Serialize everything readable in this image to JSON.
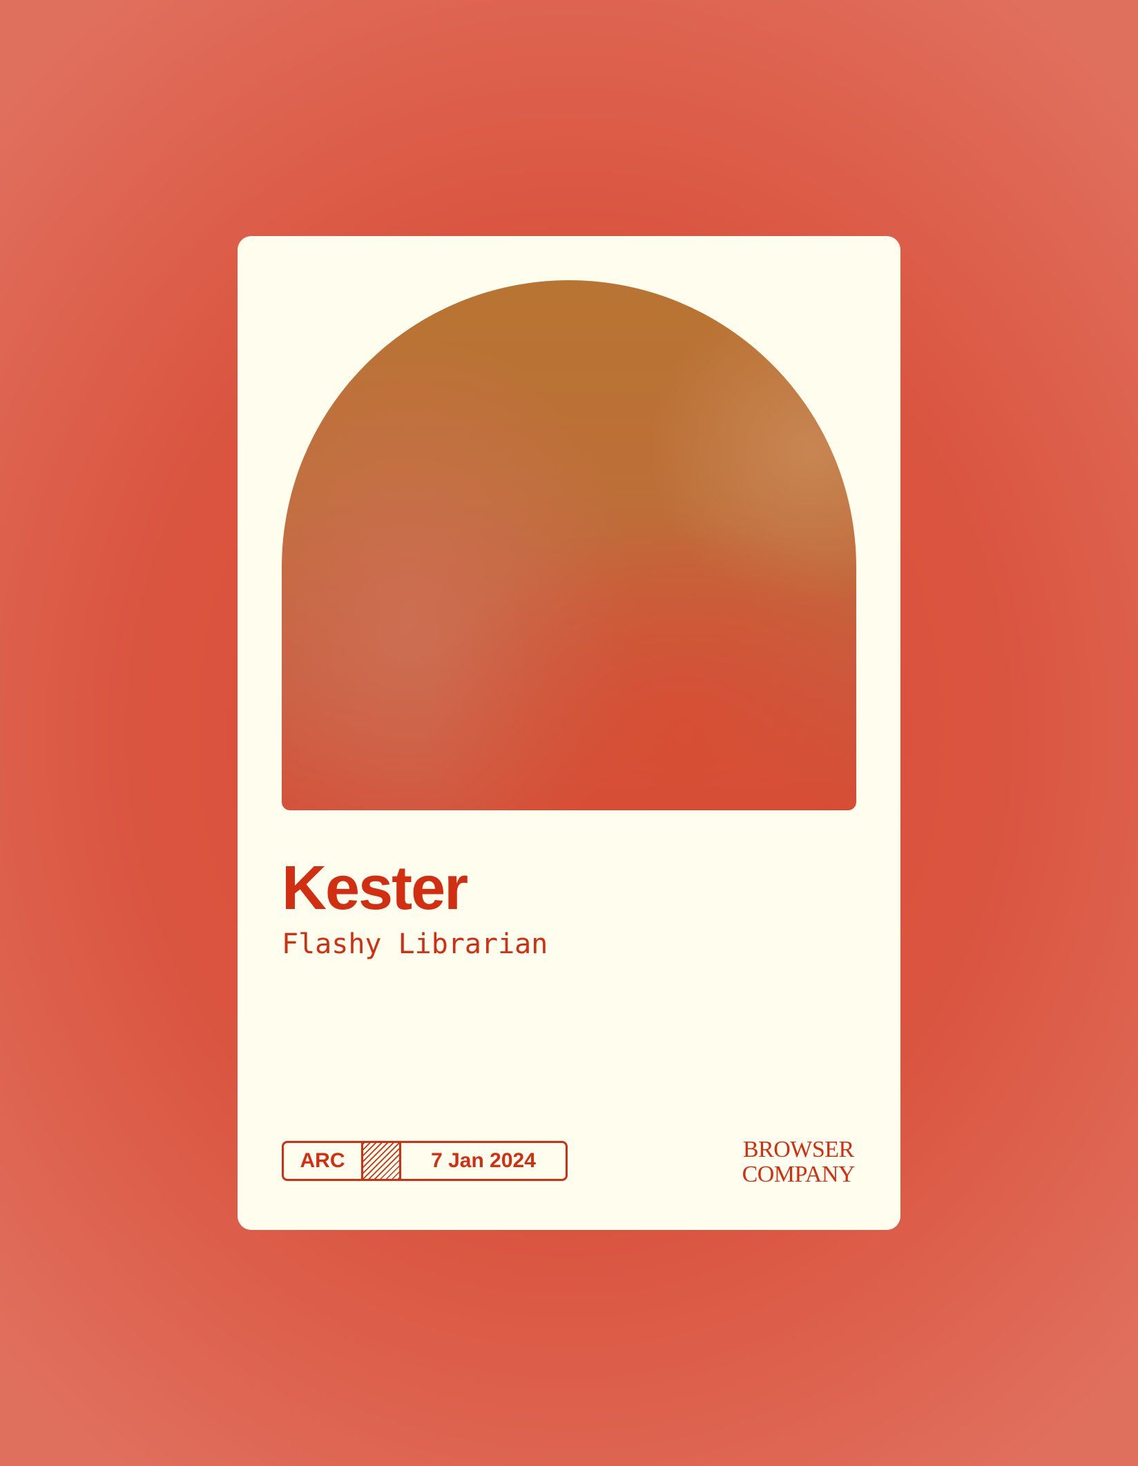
{
  "card": {
    "name": "Kester",
    "role": "Flashy Librarian",
    "badge": {
      "code": "ARC",
      "date": "7 Jan 2024"
    },
    "logo": {
      "line1": "BROWSER",
      "line2": "COMPANY"
    }
  },
  "colors": {
    "background": "#d84a35",
    "card": "#fffdee",
    "accent": "#d12e12"
  }
}
